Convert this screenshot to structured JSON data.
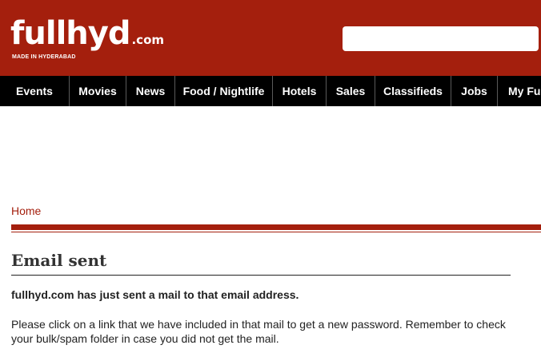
{
  "header": {
    "logo_main": "fullhyd",
    "logo_suffix": ".com",
    "logo_tagline": "MADE IN HYDERABAD",
    "search_placeholder": "",
    "search_value": ""
  },
  "nav": {
    "items": [
      {
        "label": "Events"
      },
      {
        "label": "Movies"
      },
      {
        "label": "News"
      },
      {
        "label": "Food / Nightlife"
      },
      {
        "label": "Hotels"
      },
      {
        "label": "Sales"
      },
      {
        "label": "Classifieds"
      },
      {
        "label": "Jobs"
      },
      {
        "label": "My Ful"
      }
    ]
  },
  "breadcrumb": {
    "home_label": "Home"
  },
  "main": {
    "title": "Email sent",
    "lead": "fullhyd.com has just sent a mail to that email address.",
    "body": "Please click on a link that we have included in that mail to get a new password. Remember to check your bulk/spam folder in case you did not get the mail."
  },
  "colors": {
    "brand": "#a41f0d",
    "nav_background": "#000000",
    "text": "#222222"
  }
}
